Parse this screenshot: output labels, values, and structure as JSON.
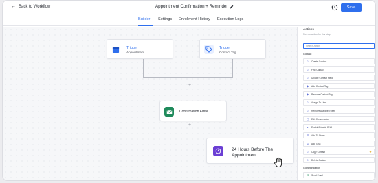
{
  "header": {
    "back_label": "Back to Workflow",
    "workflow_title": "Appointment Confirmation + Reminder",
    "save_label": "Save"
  },
  "tabs": [
    {
      "label": "Builder",
      "active": true
    },
    {
      "label": "Settings",
      "active": false
    },
    {
      "label": "Enrollment History",
      "active": false
    },
    {
      "label": "Execution Logs",
      "active": false
    }
  ],
  "canvas": {
    "trigger1": {
      "title": "Trigger",
      "subtitle": "Appointment"
    },
    "trigger2": {
      "title": "Trigger",
      "subtitle": "Contact Tag"
    },
    "email_action": {
      "title": "Confirmation Email"
    },
    "wait_action": {
      "title": "24 Hours Before The Appointment"
    }
  },
  "panel": {
    "title": "Actions",
    "description": "Pick an action for this step",
    "search_placeholder": "Search Action",
    "contact_section": "Contact",
    "contact_actions": [
      "Create Contact",
      "Find Contact",
      "Update Contact Field",
      "Add Contact Tag",
      "Remove Contact Tag",
      "Assign To User",
      "Remove Assigned User",
      "Edit Conversation",
      "Enable/Disable DND",
      "Add To Notes",
      "Add Task",
      "Copy Contact",
      "Delete Contact"
    ],
    "communication_section": "Communication",
    "communication_actions": [
      "Send Email"
    ]
  },
  "colors": {
    "accent": "#2f6fed",
    "appointment_icon_bg": "#2f6fed",
    "tag_icon_bg": "#e8efff",
    "email_icon_bg": "#1f8a5b",
    "wait_icon_bg": "#6b3fd4"
  }
}
